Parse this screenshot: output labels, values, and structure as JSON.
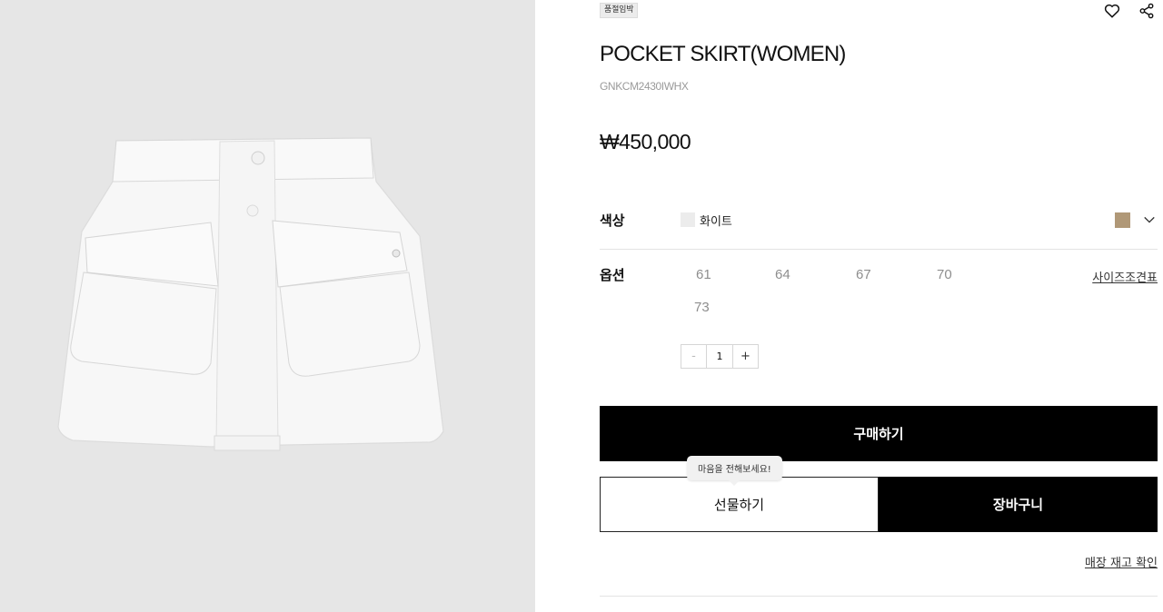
{
  "product": {
    "badge": "품절임박",
    "name": "POCKET SKIRT(WOMEN)",
    "code": "GNKCM2430IWHX",
    "price": "₩450,000"
  },
  "header_actions": {
    "wishlist_icon": "heart-icon",
    "share_icon": "share-icon"
  },
  "color": {
    "label": "색상",
    "selected_name": "화이트",
    "selected_hex": "#ececec",
    "alternate_hex": "#b09877",
    "expand_icon": "chevron-down-icon"
  },
  "option": {
    "label": "옵션",
    "sizes": [
      "61",
      "64",
      "67",
      "70",
      "73"
    ],
    "size_chart_label": "사이즈조견표"
  },
  "quantity": {
    "minus": "-",
    "value": "1",
    "plus": "+"
  },
  "buttons": {
    "buy": "구매하기",
    "gift": "선물하기",
    "cart": "장바구니",
    "gift_tooltip": "마음을 전해보세요!"
  },
  "links": {
    "store_stock": "매장 재고 확인"
  },
  "colors": {
    "gallery_bg": "#e6e6e6",
    "primary_button": "#000000"
  }
}
